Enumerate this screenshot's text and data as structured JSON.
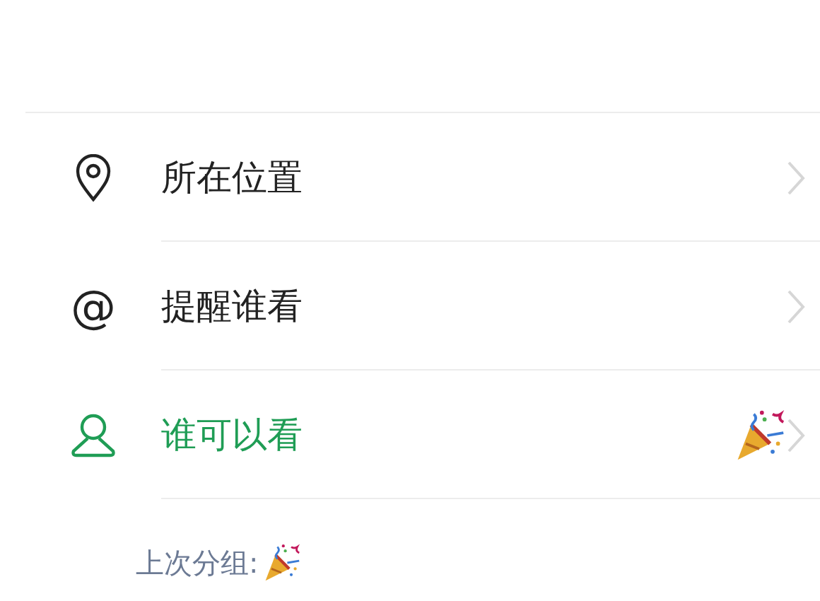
{
  "rows": [
    {
      "kind": "location",
      "label": "所在位置",
      "selected": false,
      "tag": false
    },
    {
      "kind": "mention",
      "glyph": "@",
      "label": "提醒谁看",
      "selected": false,
      "tag": false
    },
    {
      "kind": "person",
      "label": "谁可以看",
      "selected": true,
      "tag": true
    }
  ],
  "footer": {
    "label": "上次分组:",
    "tag": true
  }
}
